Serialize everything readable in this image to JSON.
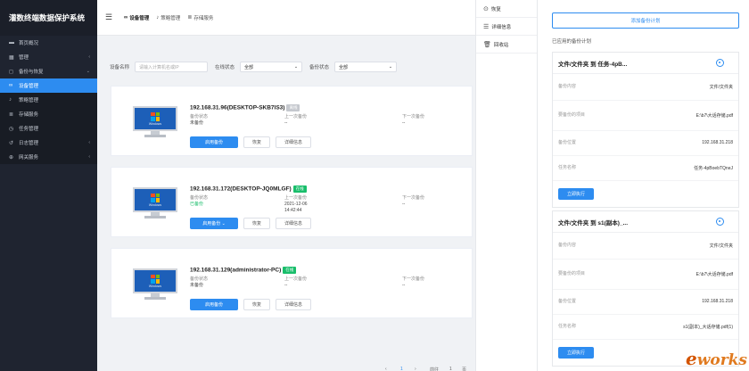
{
  "app": {
    "title": "灌数终端数据保护系统"
  },
  "sidebar": {
    "items": [
      {
        "icon": "monitor-icon",
        "glyph": "▬",
        "label": "首页概况"
      },
      {
        "icon": "grid-icon",
        "glyph": "▦",
        "label": "管理",
        "chevron": "‹"
      },
      {
        "icon": "backup-icon",
        "glyph": "◻",
        "label": "备份与恢复",
        "chevron": "⌄"
      },
      {
        "icon": "link-icon",
        "glyph": "∞",
        "label": "设备管理",
        "active": true
      },
      {
        "icon": "music-icon",
        "glyph": "♪",
        "label": "策略管理"
      },
      {
        "icon": "storage-icon",
        "glyph": "≣",
        "label": "存储服务"
      },
      {
        "icon": "clock-icon",
        "glyph": "◷",
        "label": "任务管理"
      },
      {
        "icon": "log-icon",
        "glyph": "↺",
        "label": "日志管理",
        "chevron": "‹"
      },
      {
        "icon": "globe-icon",
        "glyph": "⊕",
        "label": "网关服务",
        "chevron": "‹"
      }
    ]
  },
  "topbar": {
    "tabs": [
      {
        "icon": "link-icon",
        "glyph": "∞",
        "label": "设备管理"
      },
      {
        "icon": "music-icon",
        "glyph": "♪",
        "label": "策略管理"
      },
      {
        "icon": "storage-icon",
        "glyph": "≣",
        "label": "存储服务"
      }
    ]
  },
  "filter": {
    "name_label": "设备名称",
    "name_placeholder": "请输入计算机名或IP",
    "online_label": "在线状态",
    "online_value": "全部",
    "backup_label": "备份状态",
    "backup_value": "全部"
  },
  "devices": [
    {
      "host": "192.168.31.96(DESKTOP-SKB7IS3)",
      "status": "离线",
      "status_color": "#c5c8ce",
      "k1": "备份状态",
      "v1": "未备份",
      "k2": "上一次备份",
      "v2": "--",
      "k3": "下一次备份",
      "v3": "--",
      "v2b": "",
      "btn_primary": "启用备份",
      "btn_restore": "恢复",
      "btn_detail": "详细信息"
    },
    {
      "host": "192.168.31.172(DESKTOP-JQ0MLGF)",
      "status": "在线",
      "status_color": "#19be6b",
      "k1": "备份状态",
      "v1": "已备份",
      "k2": "上一次备份",
      "v2": "2021-12-06",
      "k3": "下一次备份",
      "v3": "--",
      "v2b": "14:42:44",
      "btn_primary": "启用备份 ⌄",
      "btn_restore": "恢复",
      "btn_detail": "详细信息"
    },
    {
      "host": "192.168.31.129(administrator-PC)",
      "status": "在线",
      "status_color": "#19be6b",
      "k1": "备份状态",
      "v1": "未备份",
      "k2": "上一次备份",
      "v2": "--",
      "k3": "下一次备份",
      "v3": "--",
      "v2b": "",
      "btn_primary": "启用备份",
      "btn_restore": "恢复",
      "btn_detail": "详细信息"
    }
  ],
  "pc": {
    "label": "Windows"
  },
  "pager": {
    "prev": "‹",
    "page": "1",
    "next": "›",
    "goto": "前往",
    "page_input": "1",
    "unit": "页"
  },
  "context_menu": {
    "items": [
      {
        "icon": "restore-icon",
        "glyph": "⊙",
        "label": "恢复"
      },
      {
        "icon": "detail-icon",
        "glyph": "☰",
        "label": "详细信息"
      },
      {
        "icon": "trash-icon",
        "glyph": "🗑",
        "label": "回收站"
      }
    ]
  },
  "panel": {
    "add_label": "添加备份计划",
    "applied_label": "已应用的备份计划",
    "plans": [
      {
        "title": "文件/文件夹 到 任务-4pB...",
        "rows": [
          {
            "k": "备份内容",
            "v": "文件/文件夹"
          },
          {
            "k": "要备份的项目",
            "v": "E:\\b7\\大话存储.pdf"
          },
          {
            "k": "备份位置",
            "v": "192.168.31.218"
          },
          {
            "k": "任务名称",
            "v": "任务-4pBoebTQneJ"
          }
        ],
        "btn": "立即执行"
      },
      {
        "title": "文件/文件夹 到 s1(副本)_...",
        "rows": [
          {
            "k": "备份内容",
            "v": "文件/文件夹"
          },
          {
            "k": "要备份的项目",
            "v": "E:\\b7\\大话存储.pdf"
          },
          {
            "k": "备份位置",
            "v": "192.168.31.218"
          },
          {
            "k": "任务名称",
            "v": "s1(副本)_大话存储.pdf(1)"
          }
        ],
        "btn": "立即执行"
      }
    ]
  },
  "watermark": {
    "text": "works",
    "e": "e"
  }
}
